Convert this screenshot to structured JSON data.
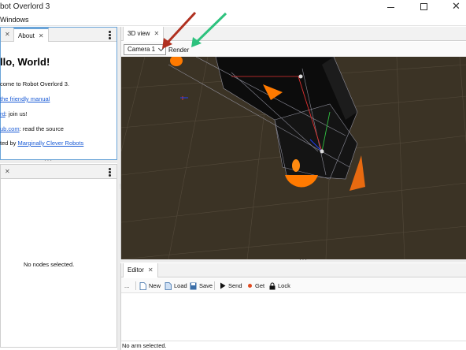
{
  "window": {
    "title": "bot Overlord 3"
  },
  "menubar": {
    "windows_label": "Windows"
  },
  "about_panel": {
    "tab_blank_close": "✕",
    "tab_label": "About",
    "tab_close": "✕",
    "heading": "llo, World!",
    "line1": "come to Robot Overlord 3.",
    "line2_link": "the friendly manual",
    "line3_link": "rd",
    "line3_rest": ": join us!",
    "line4_link": "ub.com",
    "line4_rest": ": read the source",
    "line5_pre": "ted by ",
    "line5_link": "Marginally Clever Robots"
  },
  "nodes_panel": {
    "tab_close": "✕",
    "empty_text": "No nodes selected."
  },
  "view_panel": {
    "tab_label": "3D view",
    "tab_close": "✕",
    "camera_selected": "Camera 1",
    "render_label": "Render"
  },
  "editor_panel": {
    "tab_label": "Editor",
    "tab_close": "✕",
    "toolbar": {
      "more": "...",
      "new": "New",
      "load": "Load",
      "save": "Save",
      "send": "Send",
      "get": "Get",
      "lock": "Lock"
    },
    "status": "No arm selected."
  },
  "colors": {
    "arrow_red": "#b03020",
    "arrow_green": "#2ec27e",
    "viewport_bg": "#3b3325",
    "accent_orange": "#ff7a00",
    "link_blue": "#1a5bd6"
  }
}
